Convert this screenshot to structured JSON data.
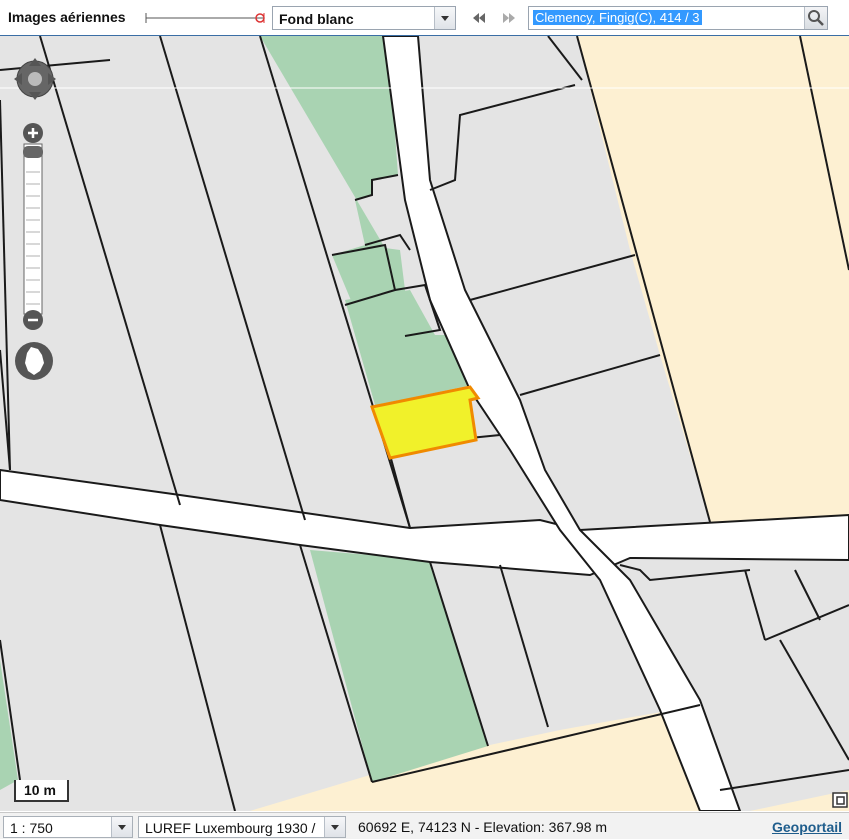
{
  "toolbar": {
    "layer_label": "Images aériennes",
    "basemap_value": "Fond blanc",
    "search_value": "Clemency, Fingig(C), 414 / 3"
  },
  "map": {
    "scale_bar_label": "10 m",
    "colors": {
      "parcel": "#e4e4e4",
      "parcel_border": "#1a1a1a",
      "road": "#ffffff",
      "green": "#a9d3b2",
      "yellow_area": "#fdf0d2",
      "selected_fill": "#f1f12a",
      "selected_border": "#f08a00"
    },
    "icons": [
      "pan-icon",
      "zoom-in-icon",
      "zoom-out-icon",
      "luxembourg-icon",
      "fullscreen-icon"
    ]
  },
  "statusbar": {
    "scale_value": "1 : 750",
    "projection_value": "LUREF Luxembourg 1930 /",
    "coordinates_text": "60692 E, 74123 N  - Elevation: 367.98 m",
    "geoportail_link": "Geoportail"
  }
}
